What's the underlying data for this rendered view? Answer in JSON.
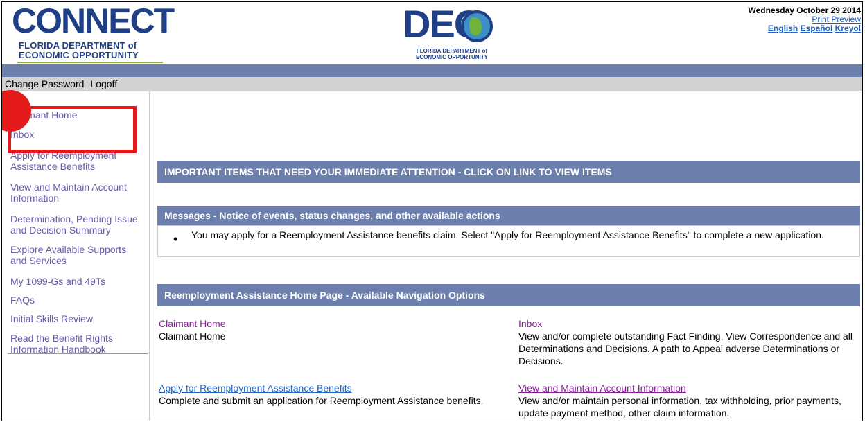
{
  "header": {
    "connect_logo_text": "CONNECT",
    "connect_logo_sub": "FLORIDA DEPARTMENT of ECONOMIC OPPORTUNITY",
    "deo_logo_text": "DEO",
    "deo_logo_sub": "FLORIDA DEPARTMENT of ECONOMIC OPPORTUNITY",
    "date": "Wednesday October 29 2014",
    "print_preview": "Print Preview",
    "lang_english": "English",
    "lang_espanol": "Español",
    "lang_kreyol": "Kreyol"
  },
  "toolbar": {
    "change_password": "Change Password",
    "logoff": "Logoff"
  },
  "sidebar": {
    "items": [
      {
        "label": "Claimant Home"
      },
      {
        "label": "Inbox"
      },
      {
        "label": "Apply for Reemployment Assistance Benefits"
      },
      {
        "label": "View and Maintain Account Information"
      },
      {
        "label": "Determination, Pending Issue and Decision Summary"
      },
      {
        "label": "Explore Available Supports and Services"
      },
      {
        "label": "My 1099-Gs and 49Ts"
      },
      {
        "label": "FAQs"
      },
      {
        "label": "Initial Skills Review"
      },
      {
        "label": "Read the Benefit Rights Information Handbook"
      }
    ]
  },
  "main": {
    "important_header": "IMPORTANT ITEMS THAT NEED YOUR IMMEDIATE ATTENTION - CLICK ON LINK TO VIEW ITEMS",
    "messages_header": "Messages - Notice of events, status changes, and other available actions",
    "message_bullet": "•",
    "message_text": "You may apply for a Reemployment Assistance benefits claim. Select \"Apply for Reemployment Assistance Benefits\" to complete a new application.",
    "nav_header": "Reemployment Assistance Home Page - Available Navigation Options",
    "options": [
      {
        "title": "Claimant Home",
        "desc": "Claimant Home"
      },
      {
        "title": "Inbox",
        "desc": "View and/or complete outstanding Fact Finding, View Correspondence and all Determinations and Decisions. A path to Appeal adverse Determinations or Decisions."
      },
      {
        "title": "Apply for Reemployment Assistance Benefits",
        "desc": "Complete and submit an application for Reemployment Assistance benefits."
      },
      {
        "title": "View and Maintain Account Information",
        "desc": "View and/or maintain personal information, tax withholding, prior payments, update payment method, other claim information."
      }
    ]
  },
  "colors": {
    "bar_blue": "#6c7fad",
    "link_purple": "#8a1c9c",
    "link_blue": "#2066c8",
    "highlight_red": "#e41a1a"
  }
}
